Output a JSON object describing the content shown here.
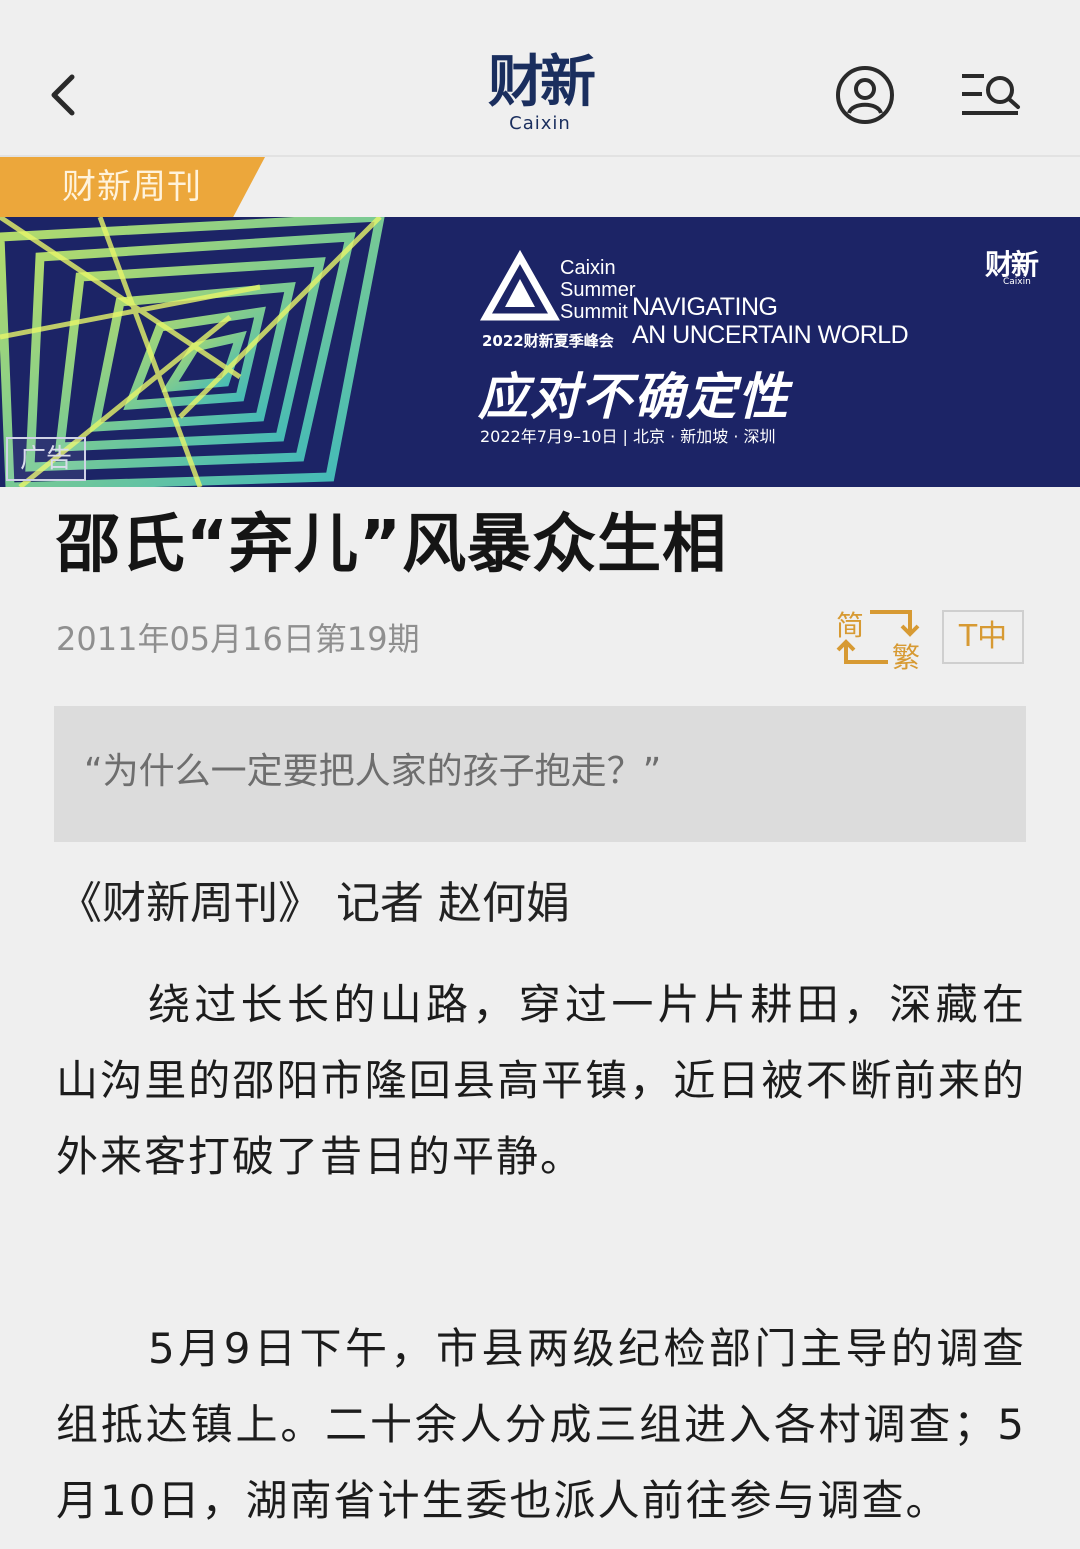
{
  "header": {
    "back_icon": "chevron-left-icon",
    "logo_cn": "财新",
    "logo_en": "Caixin",
    "user_icon": "user-icon",
    "menu_icon": "menu-search-icon"
  },
  "section_tag": "财新周刊",
  "ad_banner": {
    "logo_cn": "财新",
    "logo_en": "Caixin",
    "summit_name": "Caixin Summer Summit",
    "summit_cn": "2022财新夏季峰会",
    "tagline_line1": "NAVIGATING",
    "tagline_line2": "AN UNCERTAIN WORLD",
    "headline": "应对不确定性",
    "date_location": "2022年7月9–10日 | 北京 · 新加坡 · 深圳",
    "ad_label": "广告"
  },
  "article": {
    "title": "邵氏“弃儿”风暴众生相",
    "date_issue": "2011年05月16日第19期",
    "convert_simplified": "简",
    "convert_traditional": "繁",
    "font_size_label": "T中",
    "summary": "“为什么一定要把人家的孩子抱走？”",
    "byline": "《财新周刊》 记者 赵何娟",
    "paragraphs": [
      "绕过长长的山路，穿过一片片耕田，深藏在山沟里的邵阳市隆回县高平镇，近日被不断前来的外来客打破了昔日的平静。",
      "5月9日下午，市县两级纪检部门主导的调查组抵达镇上。二十余人分成三组进入各村调查；5月10日，湖南省计生委也派人前往参与调查。"
    ]
  },
  "colors": {
    "brand_navy": "#1a2e5e",
    "tag_orange": "#eca73b",
    "accent_gold": "#d79a33",
    "banner_bg": "#1c2466"
  }
}
